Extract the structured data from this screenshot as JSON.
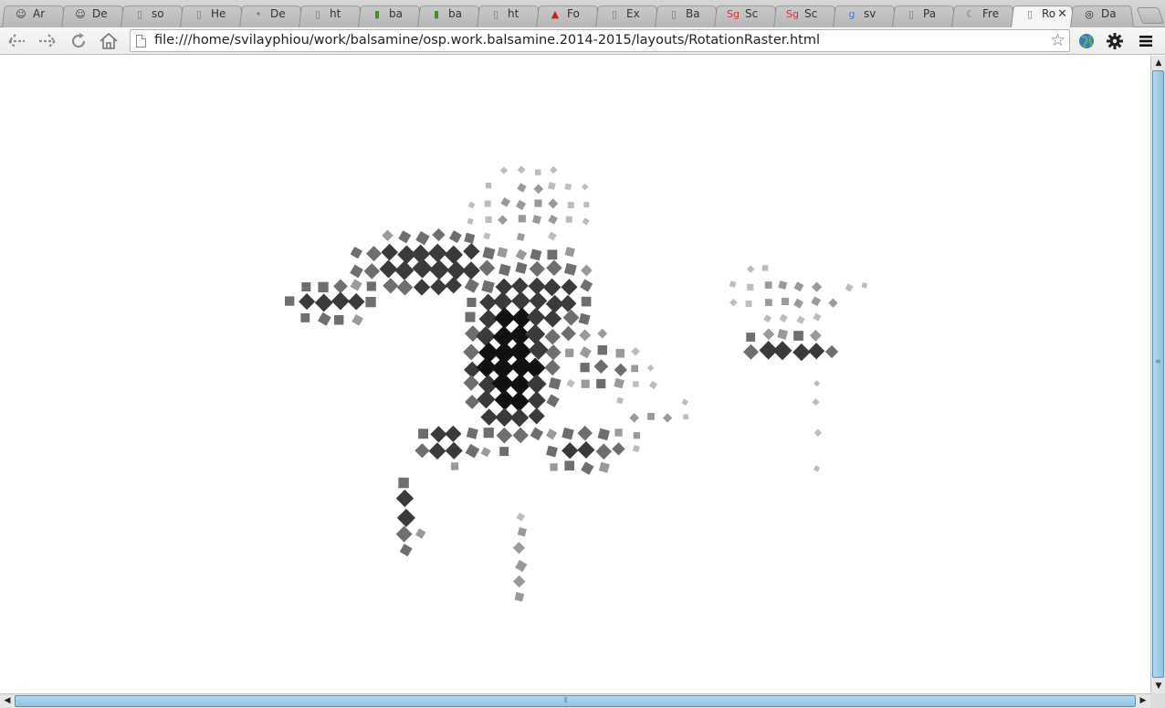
{
  "tabs": [
    {
      "title": "Ar",
      "icon": "person-icon"
    },
    {
      "title": "De",
      "icon": "person-icon"
    },
    {
      "title": "so",
      "icon": "page-icon"
    },
    {
      "title": "He",
      "icon": "page-icon"
    },
    {
      "title": "De",
      "icon": "dot-icon"
    },
    {
      "title": "ht",
      "icon": "page-icon"
    },
    {
      "title": "ba",
      "icon": "colorbar-icon"
    },
    {
      "title": "ba",
      "icon": "colorbar-icon"
    },
    {
      "title": "ht",
      "icon": "page-icon"
    },
    {
      "title": "Fo",
      "icon": "adobe-icon"
    },
    {
      "title": "Ex",
      "icon": "page-icon"
    },
    {
      "title": "Ba",
      "icon": "page-icon"
    },
    {
      "title": "Sc",
      "icon": "scribus-icon"
    },
    {
      "title": "Sc",
      "icon": "scribus-icon"
    },
    {
      "title": "sv",
      "icon": "google-icon"
    },
    {
      "title": "Pa",
      "icon": "page-icon"
    },
    {
      "title": "Fre",
      "icon": "moon-icon"
    },
    {
      "title": "Ro",
      "icon": "page-icon",
      "active": true
    },
    {
      "title": "Da",
      "icon": "target-icon"
    }
  ],
  "toolbar": {
    "url": "file:///home/svilayphiou/work/balsamine/osp.work.balsamine.2014-2015/layouts/RotationRaster.html",
    "back_icon": "back-arrow-icon",
    "forward_icon": "forward-arrow-icon",
    "reload_icon": "reload-icon",
    "home_icon": "home-icon",
    "star_icon": "star-icon",
    "globe_icon": "globe-icon",
    "wrench_icon": "gear-icon",
    "menu_icon": "menu-icon"
  },
  "colors": {
    "dark": "#111111",
    "mid": "#3a3a3a",
    "light": "#6e6e6e",
    "pale": "#9a9a9a",
    "faint": "#bdbdbd",
    "scroll_thumb": "#9fd0ea"
  }
}
